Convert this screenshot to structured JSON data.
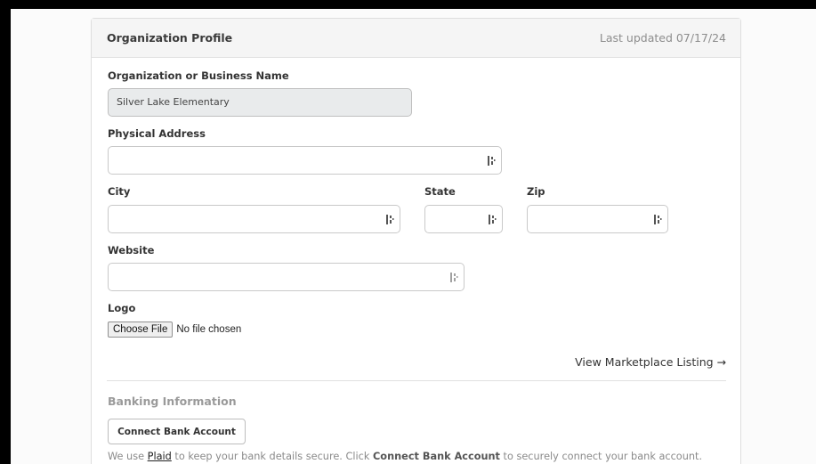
{
  "header": {
    "title": "Organization Profile",
    "last_updated": "Last updated 07/17/24"
  },
  "form": {
    "org_name": {
      "label": "Organization or Business Name",
      "value": "Silver Lake Elementary"
    },
    "address": {
      "label": "Physical Address",
      "value": ""
    },
    "city": {
      "label": "City",
      "value": ""
    },
    "state": {
      "label": "State",
      "value": ""
    },
    "zip": {
      "label": "Zip",
      "value": ""
    },
    "website": {
      "label": "Website",
      "value": ""
    },
    "logo": {
      "label": "Logo",
      "button_label": "Choose File",
      "status": "No file chosen"
    },
    "view_listing_label": "View Marketplace Listing →"
  },
  "banking": {
    "title": "Banking Information",
    "connect_label": "Connect Bank Account",
    "note_prefix": "We use ",
    "note_link": "Plaid",
    "note_middle": " to keep your bank details secure. Click ",
    "note_bold": "Connect Bank Account",
    "note_suffix": " to securely connect your bank account."
  },
  "icons": {
    "field_icon": "password-manager-icon"
  },
  "colors": {
    "header_bg": "#f5f5f5",
    "readonly_bg": "#e9ebec",
    "muted_text": "#8d8d8d"
  }
}
